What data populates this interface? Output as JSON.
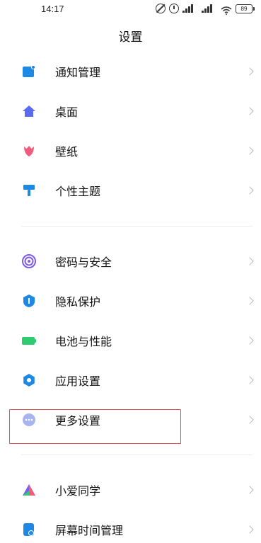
{
  "status_bar": {
    "time": "14:17",
    "battery": "89"
  },
  "header": {
    "title": "设置"
  },
  "groups": [
    {
      "items": [
        {
          "label": "通知管理",
          "icon": "notification-icon",
          "color": "#1e88e5"
        },
        {
          "label": "桌面",
          "icon": "home-icon",
          "color": "#5b6bf0"
        },
        {
          "label": "壁纸",
          "icon": "tulip-icon",
          "color": "#ef5c7e"
        },
        {
          "label": "个性主题",
          "icon": "paint-roller-icon",
          "color": "#1e88e5"
        }
      ]
    },
    {
      "items": [
        {
          "label": "密码与安全",
          "icon": "fingerprint-icon",
          "color": "#7c5ce8"
        },
        {
          "label": "隐私保护",
          "icon": "shield-icon",
          "color": "#1e88e5"
        },
        {
          "label": "电池与性能",
          "icon": "battery-icon",
          "color": "#2ecc71"
        },
        {
          "label": "应用设置",
          "icon": "gear-icon",
          "color": "#1e88e5"
        },
        {
          "label": "更多设置",
          "icon": "more-dots-icon",
          "color": "#a8b4f0"
        }
      ]
    },
    {
      "items": [
        {
          "label": "小爱同学",
          "icon": "xiaoai-icon",
          "color": "#7b5cf0"
        },
        {
          "label": "屏幕时间管理",
          "icon": "screen-time-icon",
          "color": "#1e88e5"
        }
      ]
    }
  ]
}
